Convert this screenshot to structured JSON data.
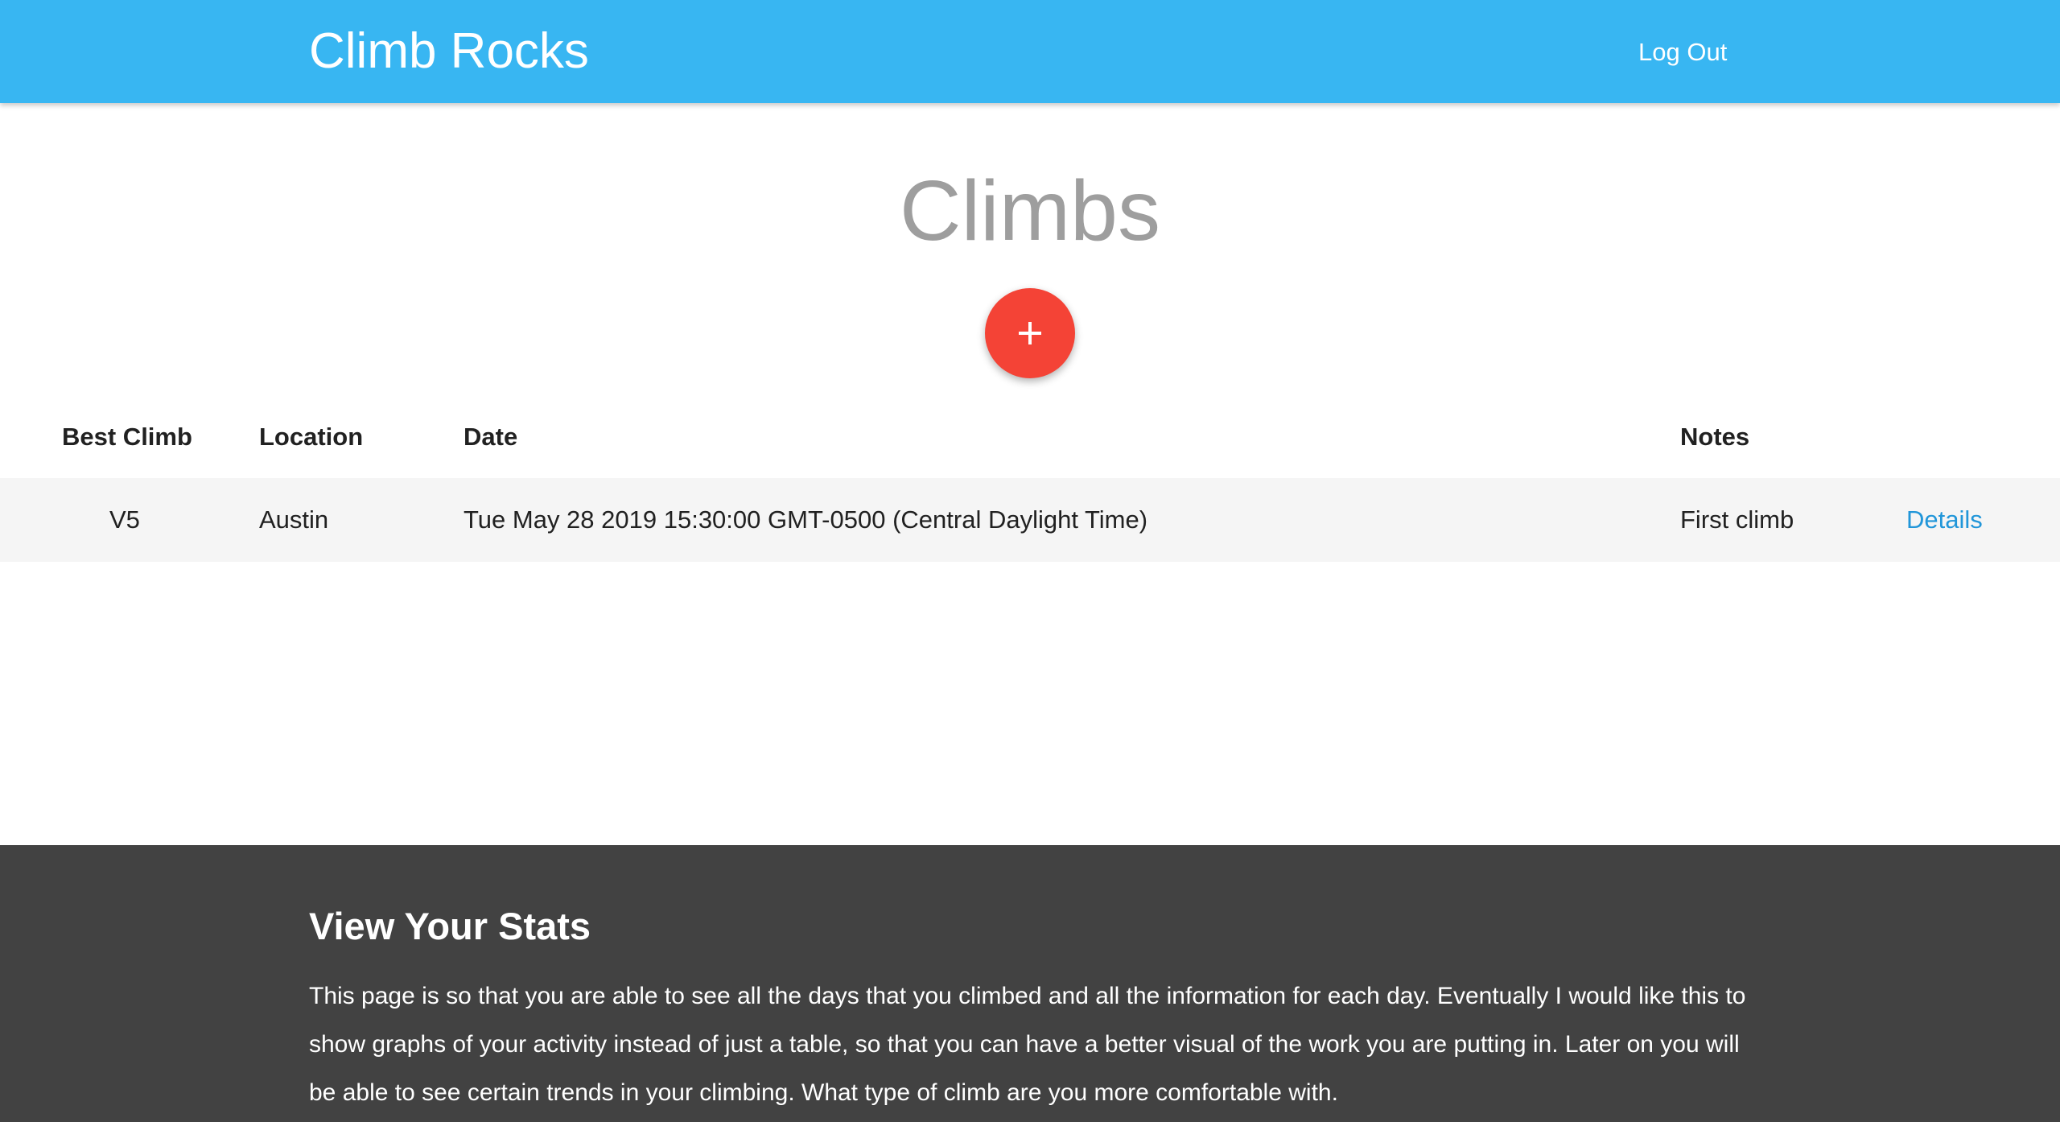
{
  "navbar": {
    "brand": "Climb Rocks",
    "logout_label": "Log Out",
    "background_color": "#38b6f2"
  },
  "main": {
    "title": "Climbs",
    "add_button": {
      "icon": "plus-icon",
      "color": "#f44336"
    }
  },
  "table": {
    "headers": [
      "Best Climb",
      "Location",
      "Date",
      "Notes"
    ],
    "rows": [
      {
        "best_climb": "V5",
        "location": "Austin",
        "date": "Tue May 28 2019 15:30:00 GMT-0500 (Central Daylight Time)",
        "notes": "First climb",
        "details_label": "Details"
      }
    ]
  },
  "footer": {
    "title": "View Your Stats",
    "text": "This page is so that you are able to see all the days that you climbed and all the information for each day. Eventually I would like this to show graphs of your activity instead of just a table, so that you can have a better visual of the work you are putting in. Later on you will be able to see certain trends in your climbing. What type of climb are you more comfortable with.",
    "background_color": "#424242"
  }
}
